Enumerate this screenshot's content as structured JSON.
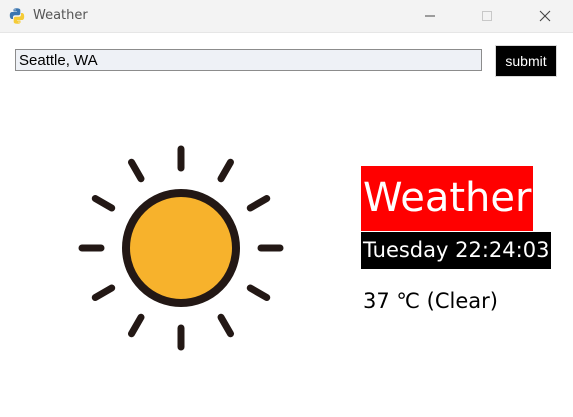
{
  "window": {
    "title": "Weather",
    "icon": "python-icon"
  },
  "search": {
    "value": "Seattle, WA",
    "submit_label": "submit"
  },
  "weather": {
    "icon": "sun-icon",
    "title": "Weather",
    "datetime": "Tuesday 22:24:03",
    "temperature": "37 ℃ (Clear)"
  },
  "colors": {
    "title_bg": "#ff0000",
    "time_bg": "#000000",
    "submit_bg": "#000000",
    "sun_fill": "#f7b22c",
    "sun_outline": "#231815"
  }
}
